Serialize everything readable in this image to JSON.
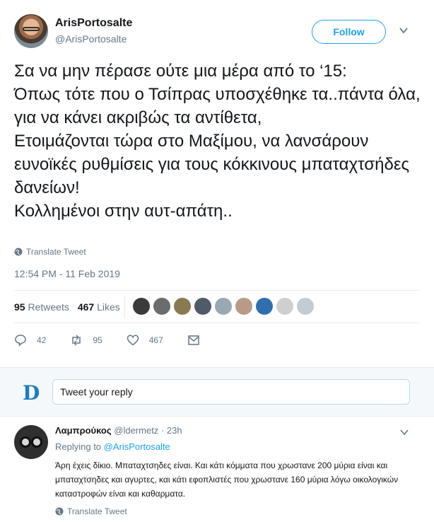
{
  "tweet": {
    "author_name": "ArisPortosalte",
    "author_handle": "@ArisPortosalte",
    "follow_label": "Follow",
    "text": "Σα να μην πέρασε ούτε μια μέρα από το ‘15:\nΌπως τότε που ο Τσίπρας υποσχέθηκε τα..πάντα όλα, για να κάνει ακριβώς τα αντίθετα,\nΕτοιμάζονται τώρα στο Μαξίμου, να λανσάρουν ευνοϊκές ρυθμίσεις για τους κόκκινους μπαταχτσήδες δανείων!\nΚολλημένοι στην αυτ-απάτη..",
    "translate_label": "Translate Tweet",
    "timestamp": "12:54 PM - 11 Feb 2019",
    "retweets_count": "95",
    "retweets_label": "Retweets",
    "likes_count": "467",
    "likes_label": "Likes",
    "likers_colors": [
      "#3b3b3b",
      "#6c6c6c",
      "#8a7a52",
      "#4f5b66",
      "#9aa8b4",
      "#b89a86",
      "#2f6fb0",
      "#cfcfcf",
      "#c3ccd3"
    ],
    "actions": {
      "reply_count": "42",
      "retweet_count": "95",
      "like_count": "467"
    }
  },
  "reply_box": {
    "logo": "D",
    "placeholder": "Tweet your reply"
  },
  "reply": {
    "author_name": "Λαμπρούκος",
    "author_handle": "@ldermetz",
    "separator": "·",
    "time": "23h",
    "replying_prefix": "Replying to",
    "replying_to": "@ArisPortosalte",
    "text": "Άρη έχεις δίκιο. Μπαταχτσηδες είναι. Και κάτι κόμματα που χρωστανε 200 μύρια είναι και μπαταχτσηδες και αγυρτες, και κάτι εφοπλιστές που χρωστανε 160 μύρια λόγω οικολογικών καταστροφών είναι και καθαρματα.",
    "translate_label": "Translate Tweet"
  },
  "colors": {
    "accent": "#1da1f2",
    "muted": "#657786",
    "text": "#14171a",
    "logo": "#1b7cc2"
  }
}
